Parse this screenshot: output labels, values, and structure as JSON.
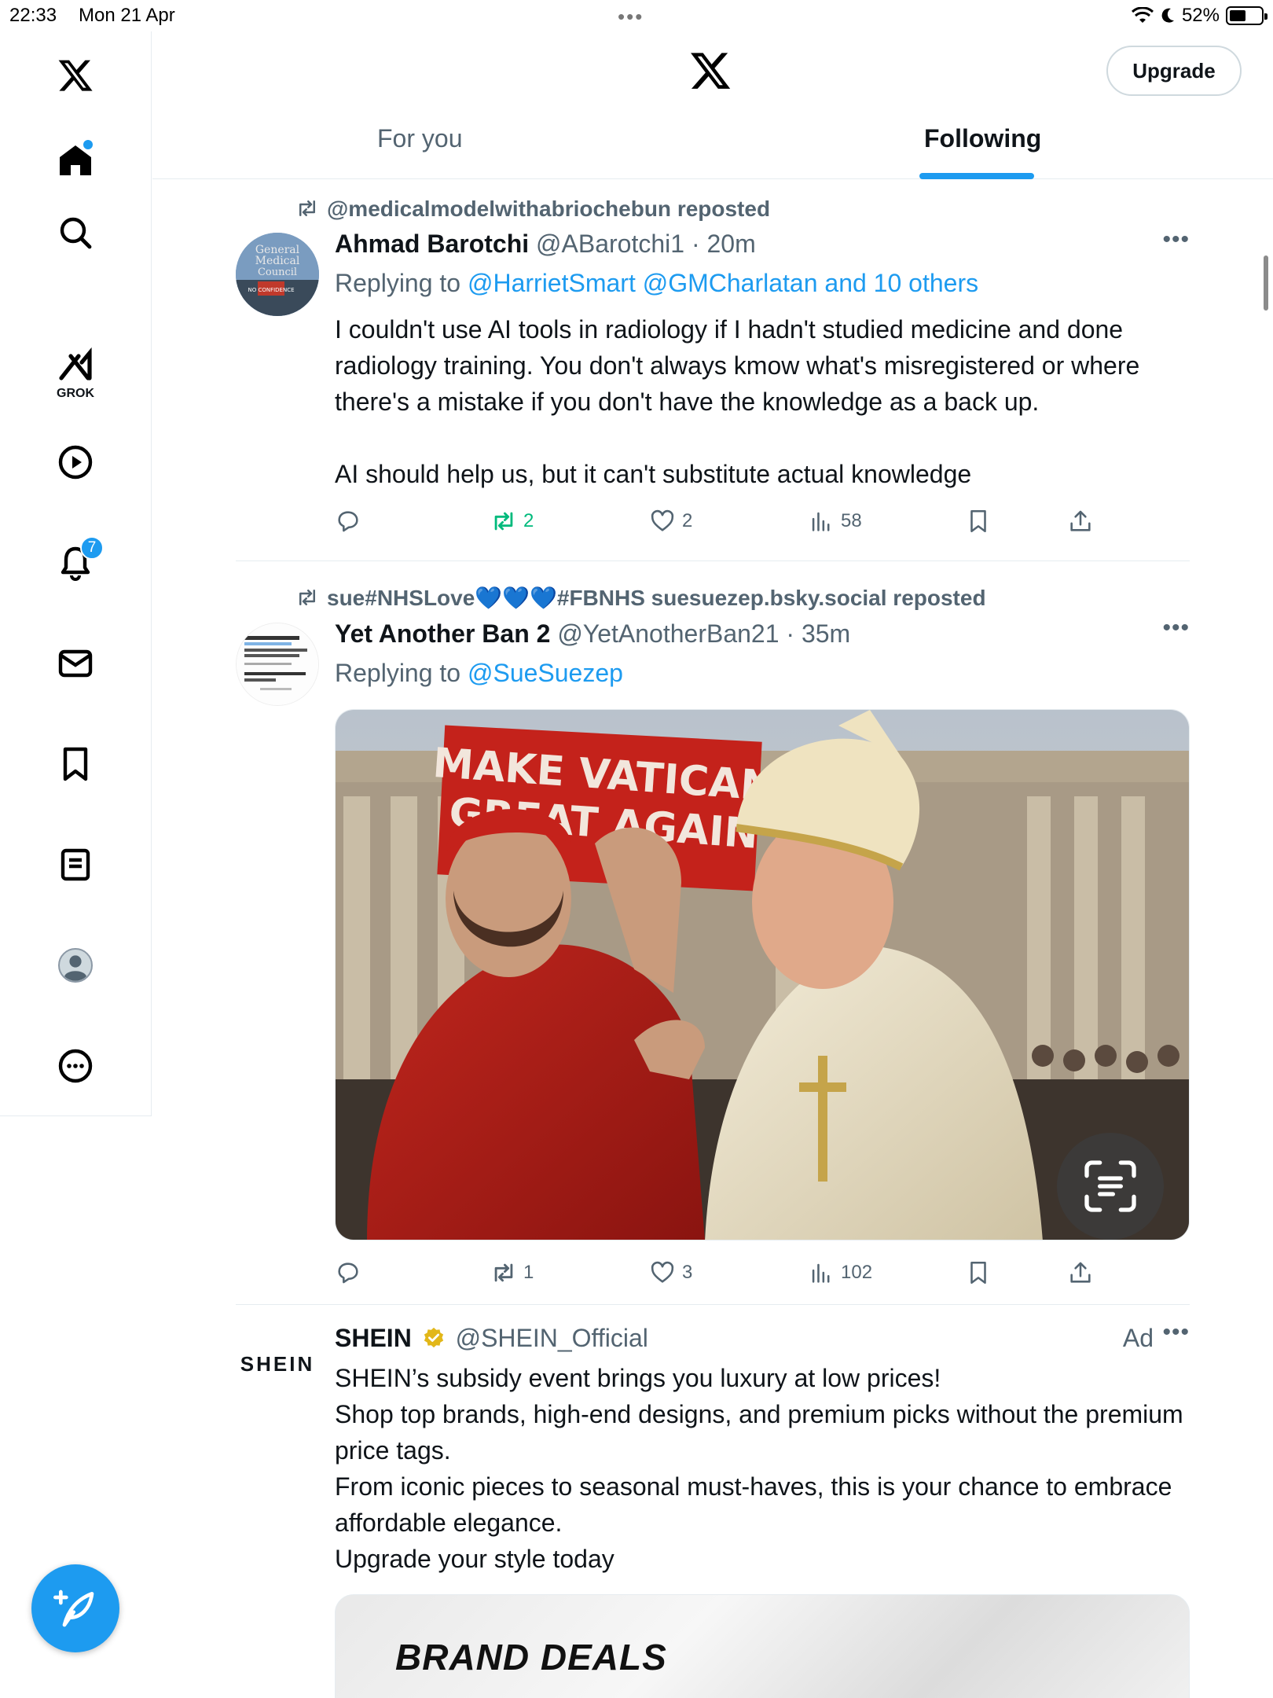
{
  "status_bar": {
    "time": "22:33",
    "date": "Mon 21 Apr",
    "battery": "52%",
    "battery_level": 0.52
  },
  "sidebar": {
    "items": [
      {
        "name": "x-logo"
      },
      {
        "name": "home-icon"
      },
      {
        "name": "search-icon"
      },
      {
        "name": "grok-icon",
        "label": "GROK"
      },
      {
        "name": "video-icon"
      },
      {
        "name": "notifications-icon",
        "badge": "7"
      },
      {
        "name": "messages-icon"
      },
      {
        "name": "bookmarks-icon"
      },
      {
        "name": "lists-icon"
      },
      {
        "name": "profile-icon"
      },
      {
        "name": "more-icon"
      }
    ],
    "compose_icon": "compose-icon"
  },
  "header": {
    "upgrade_label": "Upgrade",
    "tabs": [
      {
        "label": "For you",
        "active": false
      },
      {
        "label": "Following",
        "active": true
      }
    ]
  },
  "posts": [
    {
      "reposted_by": "@medicalmodelwithabriochebun reposted",
      "name": "Ahmad Barotchi",
      "handle": "@ABarotchi1",
      "time": "20m",
      "replying_prefix": "Replying to ",
      "replying_to": "@HarrietSmart @GMCharlatan and 10 others",
      "avatar_text": [
        "General",
        "Medical",
        "Council",
        "NO CONFIDENCE"
      ],
      "text": "I couldn't use AI tools in radiology if I hadn't studied medicine and done radiology training. You don't always kmow what's misregistered or where there's a mistake if you don't have the knowledge as a back up.\n\nAI should help us, but it can't substitute actual knowledge",
      "stats": {
        "replies": "",
        "reposts": "2",
        "likes": "2",
        "views": "58"
      }
    },
    {
      "reposted_by": "sue#NHSLove💙💙💙#FBNHS suesuezep.bsky.social reposted",
      "name": "Yet Another Ban 2",
      "handle": "@YetAnotherBan21",
      "time": "35m",
      "replying_prefix": "Replying to ",
      "replying_to": "@SueSuezep",
      "image_banner": [
        "MAKE VATICAN",
        "GREAT AGAIN"
      ],
      "stats": {
        "replies": "",
        "reposts": "1",
        "likes": "3",
        "views": "102"
      }
    },
    {
      "name": "SHEIN",
      "handle": "@SHEIN_Official",
      "ad_label": "Ad",
      "logo_text": "SHEIN",
      "text": "SHEIN’s subsidy event brings you luxury at low prices!\nShop top brands, high-end designs, and premium picks without the premium price tags.\nFrom iconic pieces to seasonal must-haves, this is your chance to embrace affordable elegance.\nUpgrade your style today",
      "card_title": "BRAND DEALS"
    }
  ],
  "colors": {
    "accent": "#1d9bf0",
    "repost_green": "#00ba7c",
    "muted": "#536471"
  }
}
